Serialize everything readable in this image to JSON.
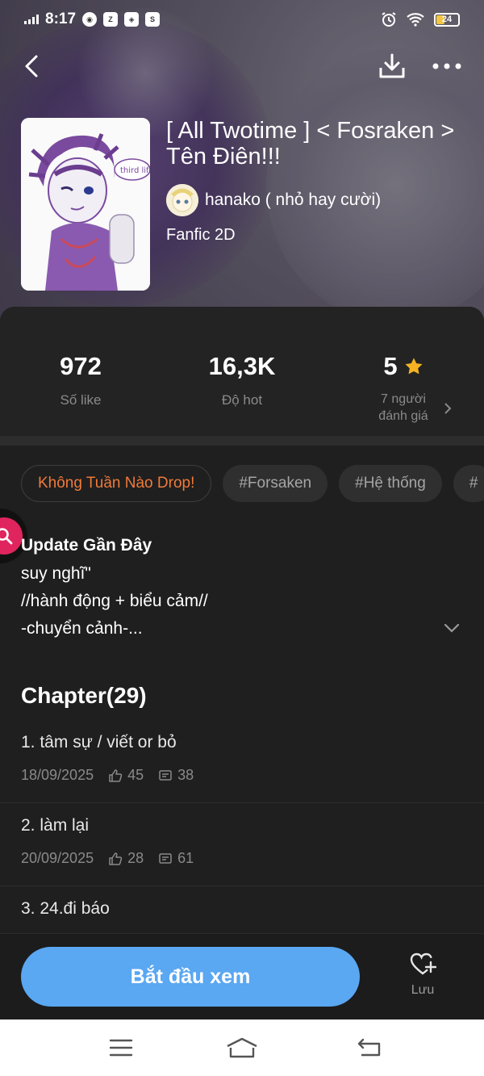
{
  "status_bar": {
    "time": "8:17",
    "battery": "24"
  },
  "story": {
    "title": "[ All Twotime ] < Fosraken > Tên Điên!!!",
    "author": "hanako ( nhỏ hay cười)",
    "genre": "Fanfic 2D",
    "cover_text": "third life"
  },
  "stats": {
    "likes": {
      "value": "972",
      "label": "Số like"
    },
    "hot": {
      "value": "16,3K",
      "label": "Độ hot"
    },
    "rating": {
      "value": "5",
      "line1": "7 người",
      "line2": "đánh giá"
    }
  },
  "tags": [
    "Không Tuần Nào Drop!",
    "#Forsaken",
    "#Hệ thống",
    "#"
  ],
  "update": {
    "heading": "Update Gần Đây",
    "lines": [
      "suy nghĩ\"",
      "//hành động + biểu cảm//",
      "-chuyển cảnh-..."
    ]
  },
  "chapter_header": "Chapter(29)",
  "chapters": [
    {
      "title": "1. tâm sự / viết or bỏ",
      "date": "18/09/2025",
      "likes": "45",
      "comments": "38"
    },
    {
      "title": "2. làm lại",
      "date": "20/09/2025",
      "likes": "28",
      "comments": "61"
    },
    {
      "title": "3. 24.đi báo"
    }
  ],
  "actions": {
    "start": "Bắt đầu xem",
    "save": "Lưu"
  },
  "colors": {
    "accent_blue": "#5aa7f2",
    "tag_orange": "#f07a3a",
    "star": "#f5b323",
    "fab": "#e0245e"
  }
}
